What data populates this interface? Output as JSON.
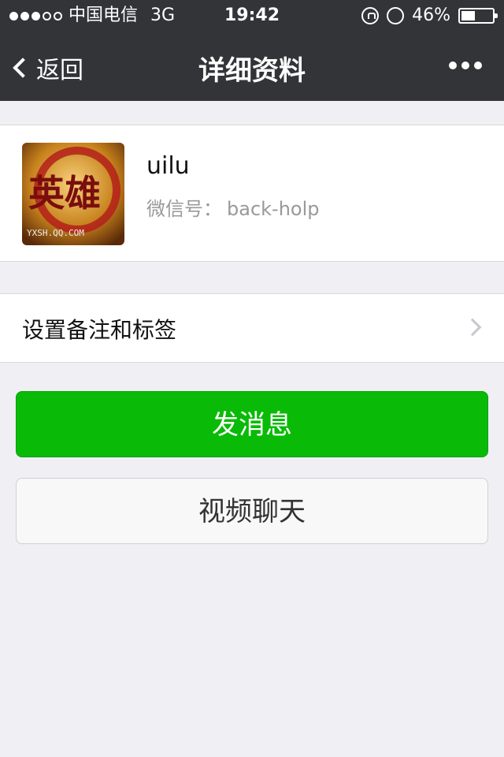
{
  "status_bar": {
    "carrier": "中国电信",
    "network": "3G",
    "time": "19:42",
    "battery_percent": "46%",
    "battery_level": 0.46,
    "signal_bars": 3,
    "signal_total": 5
  },
  "nav": {
    "back_label": "返回",
    "title": "详细资料",
    "more_icon": "more-dots-icon"
  },
  "profile": {
    "name": "uilu",
    "wechat_id_label": "微信号：",
    "wechat_id_value": "back-holp",
    "avatar_text": "英雄",
    "avatar_caption": "YXSH.QQ.COM"
  },
  "remark_row": {
    "label": "设置备注和标签"
  },
  "actions": {
    "send_message": "发消息",
    "video_chat": "视频聊天"
  },
  "colors": {
    "nav_bg": "#333438",
    "page_bg": "#efeff4",
    "primary_green": "#09bb07"
  }
}
